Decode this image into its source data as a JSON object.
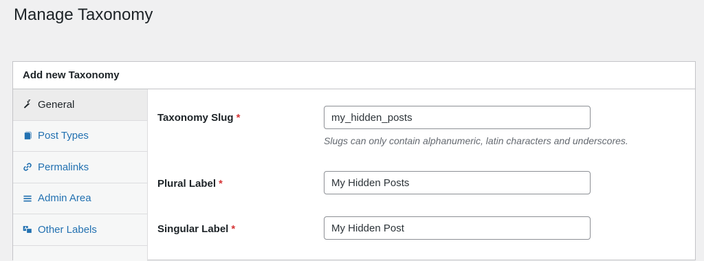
{
  "page": {
    "title": "Manage Taxonomy"
  },
  "panel": {
    "title": "Add new Taxonomy"
  },
  "tabs": [
    {
      "label": "General",
      "icon": "wrench-icon",
      "active": true
    },
    {
      "label": "Post Types",
      "icon": "post-types-icon",
      "active": false
    },
    {
      "label": "Permalinks",
      "icon": "link-icon",
      "active": false
    },
    {
      "label": "Admin Area",
      "icon": "menu-icon",
      "active": false
    },
    {
      "label": "Other Labels",
      "icon": "translation-icon",
      "active": false
    }
  ],
  "form": {
    "slug": {
      "label": "Taxonomy Slug",
      "required_mark": "*",
      "value": "my_hidden_posts",
      "hint": "Slugs can only contain alphanumeric, latin characters and underscores."
    },
    "plural": {
      "label": "Plural Label",
      "required_mark": "*",
      "value": "My Hidden Posts"
    },
    "singular": {
      "label": "Singular Label",
      "required_mark": "*",
      "value": "My Hidden Post"
    }
  },
  "colors": {
    "link": "#2271b1",
    "required": "#d63638",
    "background": "#f0f0f1"
  }
}
